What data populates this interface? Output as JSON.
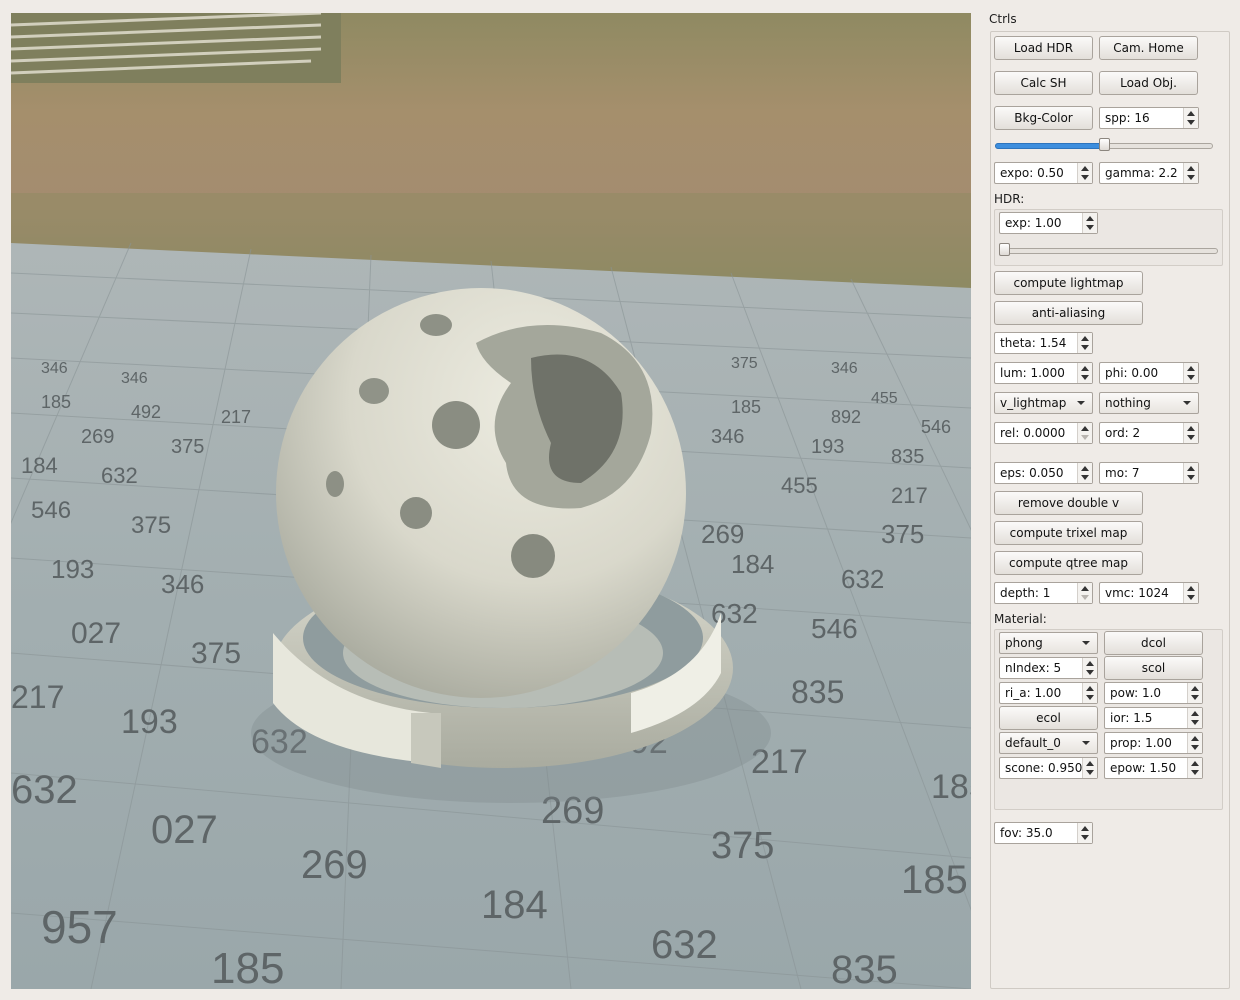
{
  "panel": {
    "title": "Ctrls",
    "buttons": {
      "load_hdr": "Load HDR",
      "cam_home": "Cam. Home",
      "calc_sh": "Calc SH",
      "load_obj": "Load Obj.",
      "bkg_color": "Bkg-Color",
      "compute_lightmap": "compute lightmap",
      "anti_aliasing": "anti-aliasing",
      "remove_double_v": "remove double v",
      "compute_trixel_map": "compute trixel map",
      "compute_qtree_map": "compute qtree map"
    },
    "spp": "spp: 16",
    "spp_slider_fraction": 0.5,
    "expo": "expo: 0.50",
    "gamma": "gamma: 2.2",
    "hdr_label": "HDR:",
    "hdr_exp": "exp: 1.00",
    "hdr_slider_fraction": 0.0,
    "theta": "theta: 1.54",
    "lum": "lum: 1.000",
    "phi": "phi: 0.00",
    "lightmap_mode": "v_lightmap",
    "secondary_mode": "nothing",
    "rel": "rel: 0.0000",
    "ord": "ord: 2",
    "eps": "eps: 0.050",
    "mo": "mo: 7",
    "depth": "depth: 1",
    "vmc": "vmc: 1024",
    "fov": "fov: 35.0"
  },
  "material": {
    "label": "Material:",
    "shader": "phong",
    "dcol": "dcol",
    "nindex": "nIndex: 5",
    "scol": "scol",
    "ri_a": "ri_a: 1.00",
    "pow": "pow: 1.0",
    "ecol": "ecol",
    "ior": "ior: 1.5",
    "preset": "default_0",
    "prop": "prop: 1.00",
    "scone": "scone: 0.950",
    "epow": "epow: 1.50"
  },
  "viewport": {
    "floor_numbers": [
      "957",
      "185",
      "632",
      "027",
      "269",
      "184",
      "375",
      "835",
      "217",
      "193",
      "346",
      "546",
      "492",
      "455",
      "892",
      "269",
      "632"
    ]
  }
}
